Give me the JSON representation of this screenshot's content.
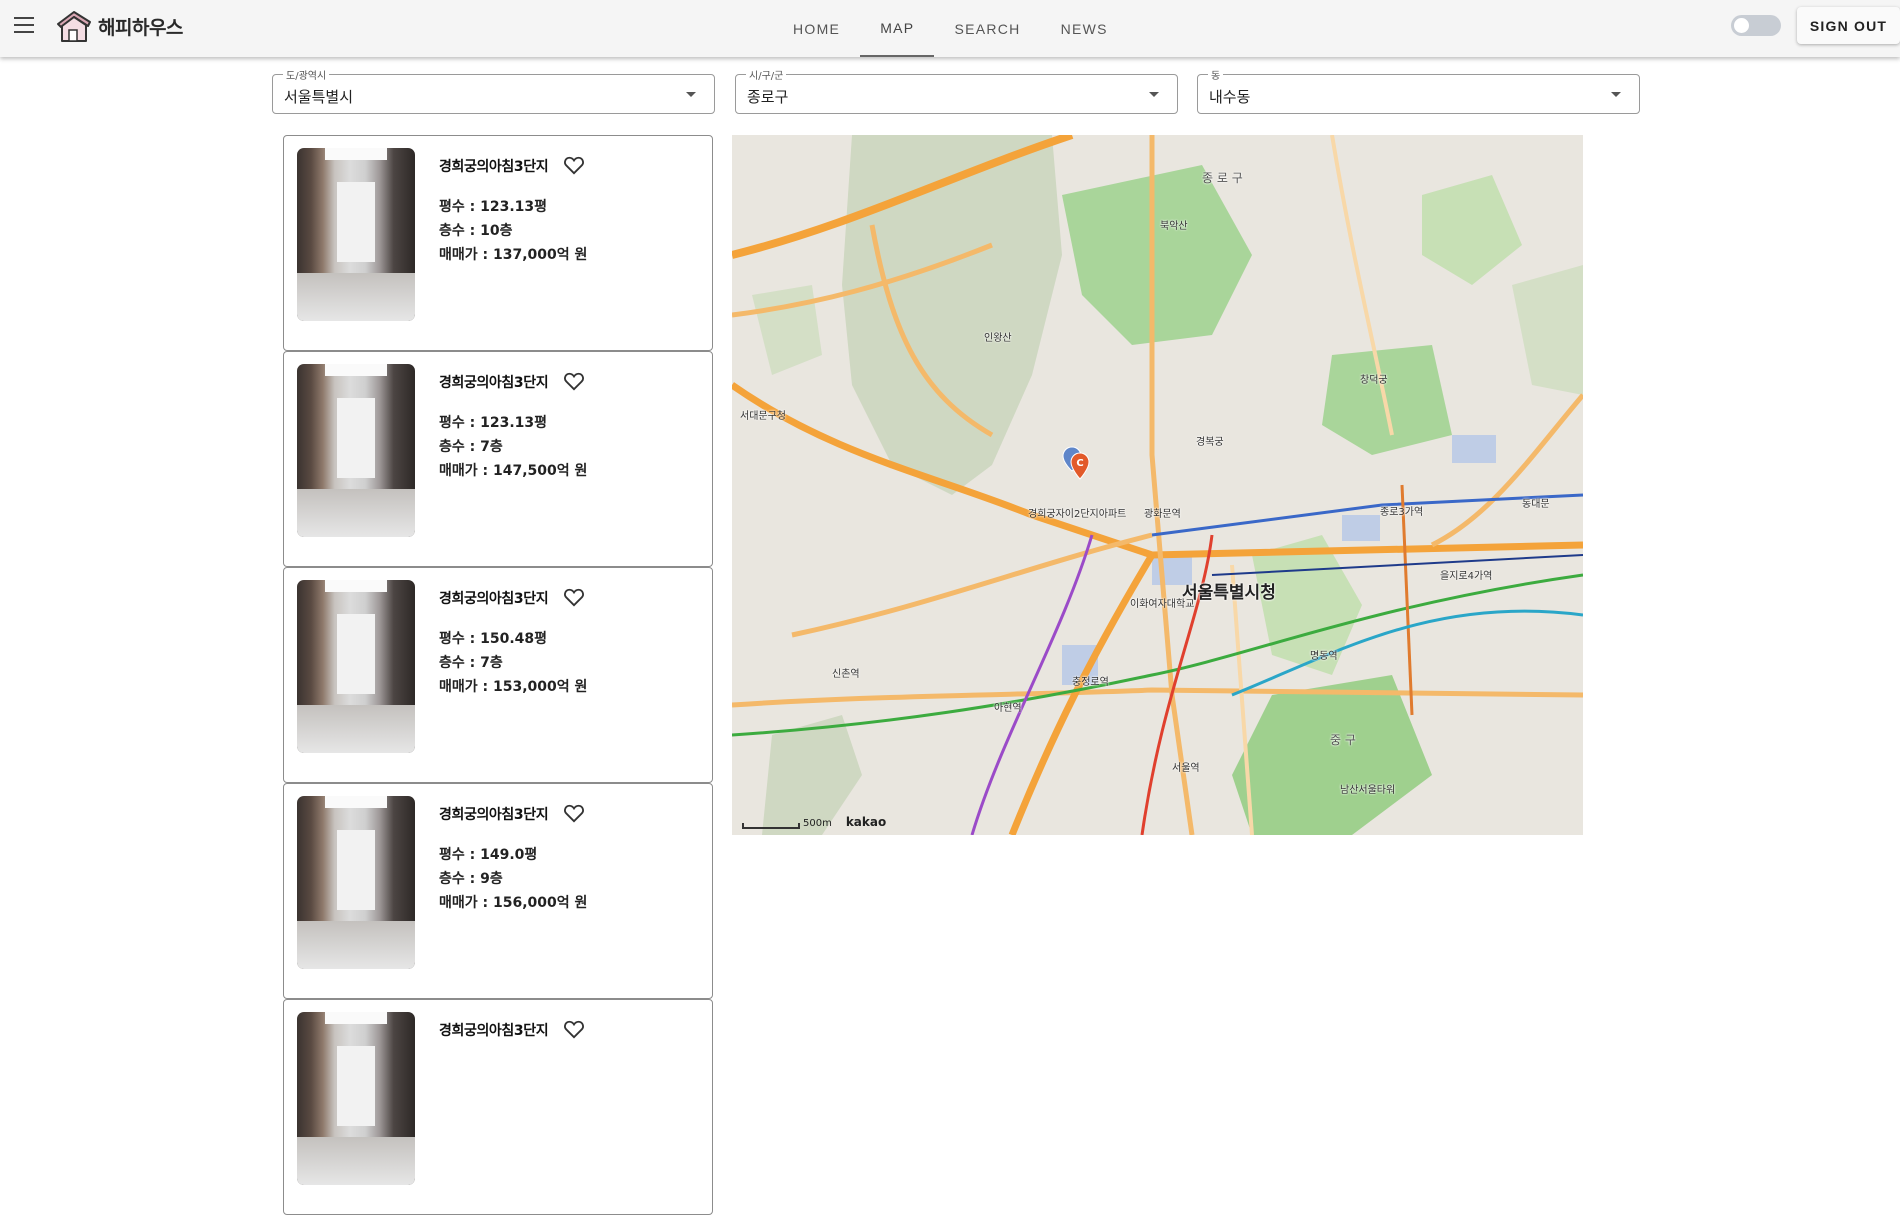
{
  "header": {
    "logo_text": "해피하우스",
    "tabs": [
      {
        "label": "HOME"
      },
      {
        "label": "MAP"
      },
      {
        "label": "SEARCH"
      },
      {
        "label": "NEWS"
      }
    ],
    "active_tab": "MAP",
    "signout_label": "SIGN OUT",
    "toggle_on": false
  },
  "filters": {
    "city": {
      "label": "도/광역시",
      "value": "서울특별시"
    },
    "district": {
      "label": "시/구/군",
      "value": "종로구"
    },
    "dong": {
      "label": "동",
      "value": "내수동"
    }
  },
  "listings": [
    {
      "name": "경희궁의아침3단지",
      "area": "평수 : 123.13평",
      "floor": "층수 : 10층",
      "price": "매매가 : 137,000억 원"
    },
    {
      "name": "경희궁의아침3단지",
      "area": "평수 : 123.13평",
      "floor": "층수 : 7층",
      "price": "매매가 : 147,500억 원"
    },
    {
      "name": "경희궁의아침3단지",
      "area": "평수 : 150.48평",
      "floor": "층수 : 7층",
      "price": "매매가 : 153,000억 원"
    },
    {
      "name": "경희궁의아침3단지",
      "area": "평수 : 149.0평",
      "floor": "층수 : 9층",
      "price": "매매가 : 156,000억 원"
    },
    {
      "name": "경희궁의아침3단지",
      "area": "",
      "floor": "",
      "price": ""
    }
  ],
  "map": {
    "scale_label": "500m",
    "provider": "kakao",
    "marker_letter": "C",
    "labels": {
      "jongno_gu": "종 로 구",
      "city_hall": "서울특별시청",
      "seodaemun": "서대문구청",
      "insan": "인왕산",
      "bugaksan": "북악산",
      "gyeongbok": "경복궁",
      "gwanghwamun": "광화문역",
      "jongno3": "종로3가역",
      "seoul_station": "서울역",
      "chungjeongno": "충정로역",
      "myeongdong": "명동역",
      "euljiro4": "을지로4가역",
      "dongdaemun": "동대문",
      "changdeok": "창덕궁",
      "jung_gu": "중 구",
      "ewha": "이화여자대학교",
      "sinchon": "신촌역",
      "ahyeon": "아현역",
      "huiheung": "경희궁자이2단지아파트",
      "namsan": "남산서울타워"
    }
  }
}
